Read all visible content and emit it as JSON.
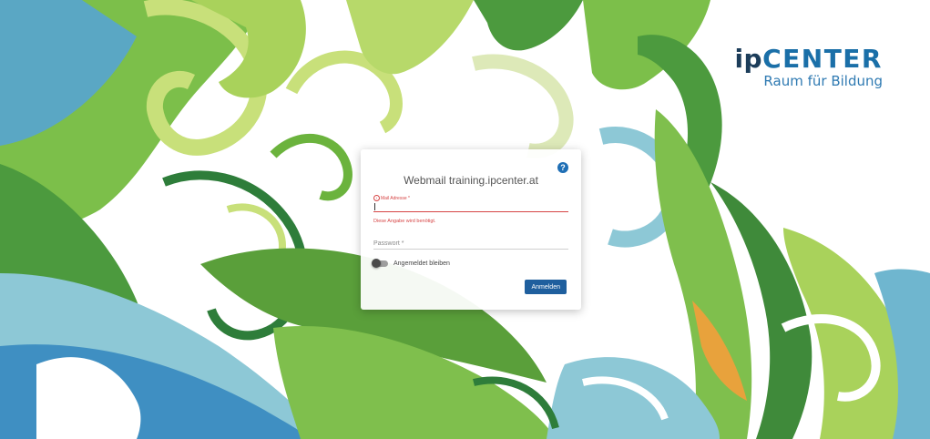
{
  "brand": {
    "logo_ip": "ip",
    "logo_center": "CENTER",
    "tagline": "Raum für Bildung"
  },
  "login": {
    "title": "Webmail training.ipcenter.at",
    "help_label": "?",
    "email_label": "Mail Adresse *",
    "email_value": "",
    "email_error": "Diese Angabe wird benötigt.",
    "password_placeholder": "Passwort *",
    "remember_label": "Angemeldet bleiben",
    "remember_checked": false,
    "submit_label": "Anmelden"
  },
  "icons": [
    "help-icon",
    "error-icon"
  ],
  "colors": {
    "error": "#d64545",
    "primary_button": "#1f5f9e",
    "brand_blue": "#1a6fa8"
  }
}
